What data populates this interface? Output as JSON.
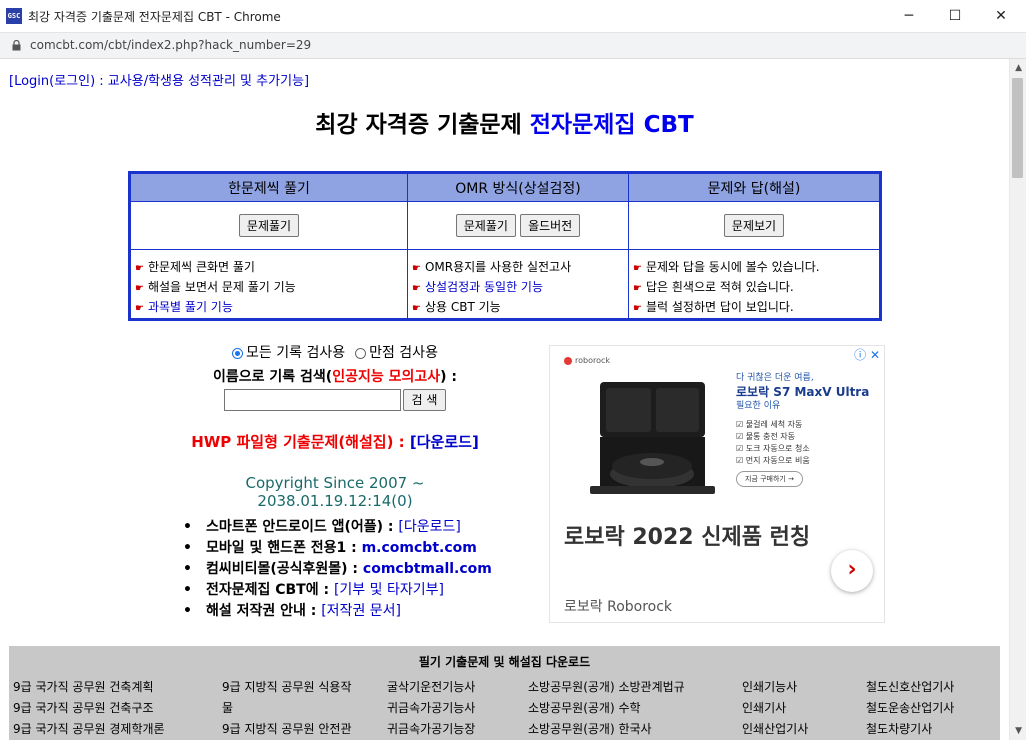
{
  "window": {
    "logo_text": "GSC",
    "title": "최강 자격증 기출문제 전자문제집 CBT - Chrome",
    "minimize": "─",
    "maximize": "☐",
    "close": "✕"
  },
  "address_bar": {
    "url": "comcbt.com/cbt/index2.php?hack_number=29"
  },
  "page": {
    "login_link": "[Login(로그인) : 교사용/학생용 성적관리 및 추가기능]",
    "title_part1": "최강 자격증 기출문제 ",
    "title_part2": "전자문제집 CBT",
    "menu": {
      "headers": [
        "한문제씩 풀기",
        "OMR 방식(상설검정)",
        "문제와 답(해설)"
      ],
      "col1_buttons": [
        "문제풀기"
      ],
      "col2_buttons": [
        "문제풀기",
        "올드버전"
      ],
      "col3_buttons": [
        "문제보기"
      ],
      "col1_desc": [
        "한문제씩 큰화면 풀기",
        "해설을 보면서 문제 풀기 기능",
        "과목별 풀기 기능"
      ],
      "col2_desc": [
        "OMR용지를 사용한 실전고사",
        "상설검정과 동일한 기능",
        "상용 CBT 기능"
      ],
      "col3_desc": [
        "문제와 답을 동시에 볼수 있습니다.",
        "답은 흰색으로 적혀 있습니다.",
        "블럭 설정하면 답이 보입니다."
      ]
    },
    "search": {
      "radio_all": "모든 기록 검사용",
      "radio_full": "만점 검사용",
      "label_prefix": "이름으로 기록 검색(",
      "label_red": "인공지능 모의고사",
      "label_suffix": ") :",
      "input_value": "",
      "button": "검 색"
    },
    "hwp": {
      "text": "HWP 파일형 기출문제(해설집) : ",
      "link": "[다운로드]"
    },
    "copyright": "Copyright Since 2007 ~ 2038.01.19.12:14(0)",
    "apps": [
      {
        "label": "스마트폰 안드로이드 앱(어플) : ",
        "link": "[다운로드]"
      },
      {
        "label": "모바일 및 핸드폰 전용1 : ",
        "link": "m.comcbt.com"
      },
      {
        "label": "컴씨비티몰(공식후원몰) : ",
        "link": "comcbtmall.com"
      },
      {
        "label": "전자문제집 CBT에 : ",
        "link": "[기부 및 타자기부]"
      },
      {
        "label": "해설 저작권 안내 : ",
        "link": "[저작권 문서]"
      }
    ],
    "ad": {
      "brand": "roborock",
      "info_icon": "ⓘ ✕",
      "copy_small": "다 귀찮은 더운 여름,",
      "copy_big": "로보락 S7 MaxV Ultra",
      "copy_sub": "필요한 이유",
      "checks": [
        "물걸레 세척 자동",
        "물통 충전 자동",
        "도크 자동으로 청소",
        "먼지 자동으로 비움"
      ],
      "cta": "지금 구매하기 →",
      "headline": "로보락 2022 신제품 런칭",
      "sub": "로보락 Roborock",
      "arrow": "›"
    },
    "downloads": {
      "title": "필기 기출문제 및 해설집 다운로드",
      "columns": [
        [
          "9급 국가직 공무원 건축계획",
          "9급 국가직 공무원 건축구조",
          "9급 국가직 공무원 경제학개론"
        ],
        [
          "9급 지방직 공무원 식용작",
          "물",
          "9급 지방직 공무원 안전관"
        ],
        [
          "굴삭기운전기능사",
          "귀금속가공기능사",
          "귀금속가공기능장"
        ],
        [
          "소방공무원(공개) 소방관계법규",
          "소방공무원(공개) 수학",
          "소방공무원(공개) 한국사"
        ],
        [
          "인쇄기능사",
          "인쇄기사",
          "인쇄산업기사"
        ],
        [
          "철도신호산업기사",
          "철도운송산업기사",
          "철도차량기사"
        ]
      ]
    }
  }
}
